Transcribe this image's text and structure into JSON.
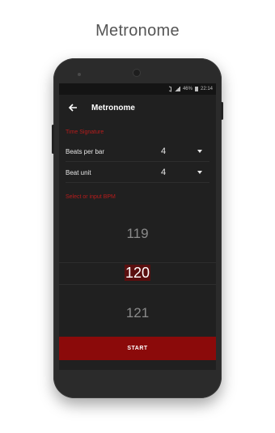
{
  "store_listing": {
    "title": "Metronome"
  },
  "status_bar": {
    "battery": "46%",
    "time": "22:14"
  },
  "toolbar": {
    "title": "Metronome"
  },
  "time_signature": {
    "header": "Time Signature",
    "beats_per_bar": {
      "label": "Beats per bar",
      "value": "4"
    },
    "beat_unit": {
      "label": "Beat unit",
      "value": "4"
    }
  },
  "bpm": {
    "header": "Select or input BPM",
    "previous": "119",
    "selected": "120",
    "next": "121"
  },
  "start_button": {
    "label": "START"
  },
  "colors": {
    "accent": "#b71c1c",
    "button": "#8b0a0a",
    "background": "#202020"
  }
}
